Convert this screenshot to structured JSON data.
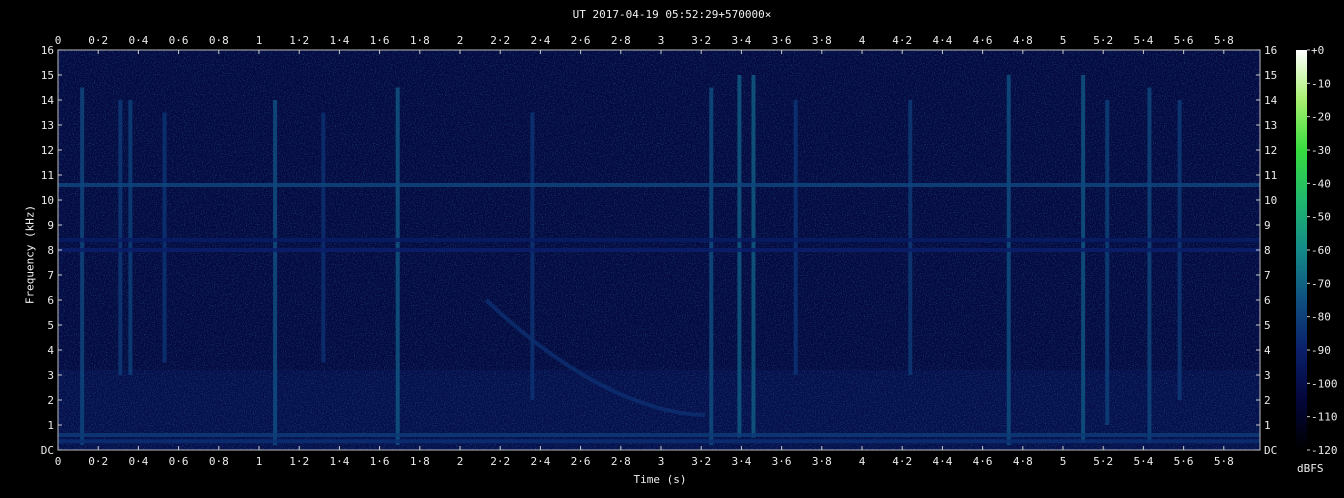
{
  "chart_data": {
    "type": "heatmap",
    "title": "UT 2017-04-19 05:52:29+570000×",
    "xlabel": "Time (s)",
    "ylabel": "Frequency (kHz)",
    "xlim": [
      0,
      5.98
    ],
    "ylim": [
      0,
      16
    ],
    "x_ticks": [
      "0",
      "0·2",
      "0·4",
      "0·6",
      "0·8",
      "1",
      "1·2",
      "1·4",
      "1·6",
      "1·8",
      "2",
      "2·2",
      "2·4",
      "2·6",
      "2·8",
      "3",
      "3·2",
      "3·4",
      "3·6",
      "3·8",
      "4",
      "4·2",
      "4·4",
      "4·6",
      "4·8",
      "5",
      "5·2",
      "5·4",
      "5·6",
      "5·8"
    ],
    "y_ticks": [
      "DC",
      "1",
      "2",
      "3",
      "4",
      "5",
      "6",
      "7",
      "8",
      "9",
      "10",
      "11",
      "12",
      "13",
      "14",
      "15",
      "16"
    ],
    "colorbar": {
      "label": "dBFS",
      "range": [
        -120,
        0
      ],
      "ticks": [
        "+0",
        "-10",
        "-20",
        "-30",
        "-40",
        "-50",
        "-60",
        "-70",
        "-80",
        "-90",
        "-100",
        "-110",
        "-120"
      ],
      "colors": [
        "#000000",
        "#03063a",
        "#0a1f6a",
        "#0f4f80",
        "#138a88",
        "#1fb86e",
        "#36dc3e",
        "#a8f070",
        "#ffffff"
      ]
    },
    "background_level_db": -103,
    "hum_lines": [
      {
        "freq_khz": 10.6,
        "level_db": -78
      },
      {
        "freq_khz": 8.4,
        "level_db": -92
      },
      {
        "freq_khz": 8.0,
        "level_db": -90
      },
      {
        "freq_khz": 0.6,
        "level_db": -82
      },
      {
        "freq_khz": 0.35,
        "level_db": -85
      }
    ],
    "impulses": [
      {
        "t": 0.12,
        "f_min": 0.2,
        "f_max": 14.5,
        "level_db": -78
      },
      {
        "t": 0.31,
        "f_min": 3.0,
        "f_max": 14.0,
        "level_db": -82
      },
      {
        "t": 0.36,
        "f_min": 3.0,
        "f_max": 14.0,
        "level_db": -80
      },
      {
        "t": 0.53,
        "f_min": 3.5,
        "f_max": 13.5,
        "level_db": -84
      },
      {
        "t": 1.08,
        "f_min": 0.2,
        "f_max": 14.0,
        "level_db": -76
      },
      {
        "t": 1.32,
        "f_min": 3.5,
        "f_max": 13.5,
        "level_db": -85
      },
      {
        "t": 1.69,
        "f_min": 0.2,
        "f_max": 14.5,
        "level_db": -74
      },
      {
        "t": 2.36,
        "f_min": 2.0,
        "f_max": 13.5,
        "level_db": -84
      },
      {
        "t": 3.25,
        "f_min": 0.2,
        "f_max": 14.5,
        "level_db": -76
      },
      {
        "t": 3.39,
        "f_min": 0.5,
        "f_max": 15.0,
        "level_db": -72
      },
      {
        "t": 3.46,
        "f_min": 0.5,
        "f_max": 15.0,
        "level_db": -72
      },
      {
        "t": 3.67,
        "f_min": 3.0,
        "f_max": 14.0,
        "level_db": -84
      },
      {
        "t": 4.24,
        "f_min": 3.0,
        "f_max": 14.0,
        "level_db": -82
      },
      {
        "t": 4.73,
        "f_min": 0.2,
        "f_max": 15.0,
        "level_db": -76
      },
      {
        "t": 5.1,
        "f_min": 0.3,
        "f_max": 15.0,
        "level_db": -74
      },
      {
        "t": 5.22,
        "f_min": 1.0,
        "f_max": 14.0,
        "level_db": -80
      },
      {
        "t": 5.43,
        "f_min": 0.3,
        "f_max": 14.5,
        "level_db": -78
      },
      {
        "t": 5.58,
        "f_min": 2.0,
        "f_max": 14.0,
        "level_db": -82
      }
    ],
    "whistler": {
      "t_start": 2.13,
      "f_start": 6.0,
      "t_end": 3.22,
      "f_end": 1.4,
      "level_db": -85
    }
  }
}
